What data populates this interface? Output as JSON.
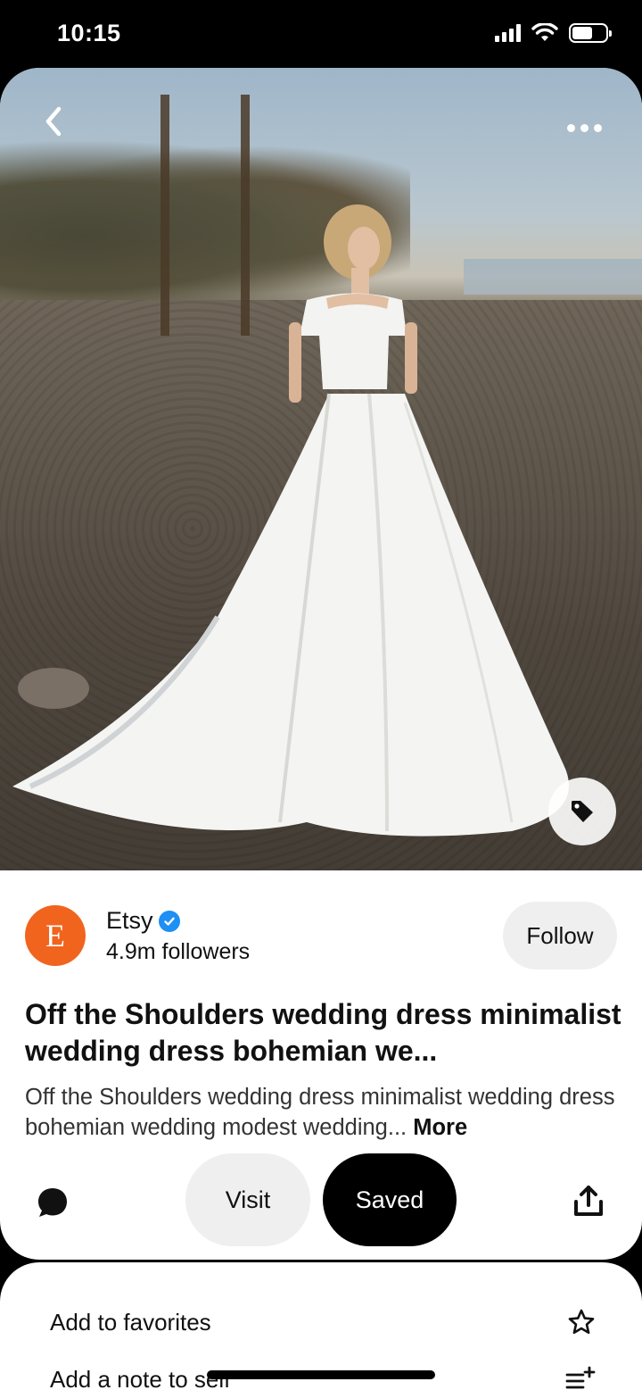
{
  "status_bar": {
    "time": "10:15"
  },
  "pin": {
    "creator": {
      "name": "Etsy",
      "avatar_letter": "E",
      "avatar_color": "#f1641e",
      "verified": true,
      "followers": "4.9m followers"
    },
    "follow_label": "Follow",
    "title": "Off the Shoulders wedding dress minimalist wedding dress bohemian we...",
    "description": "Off the Shoulders wedding dress minimalist wedding dress bohemian wedding modest wedding...",
    "more_label": "More"
  },
  "actions": {
    "visit_label": "Visit",
    "saved_label": "Saved"
  },
  "options": [
    {
      "label": "Add to favorites",
      "icon": "star-icon"
    },
    {
      "label": "Add a note to self",
      "icon": "add-note-icon"
    }
  ],
  "icons": {
    "back": "chevron-left-icon",
    "more": "more-dots-icon",
    "tag": "tag-icon",
    "comment": "comment-icon",
    "share": "share-icon"
  }
}
